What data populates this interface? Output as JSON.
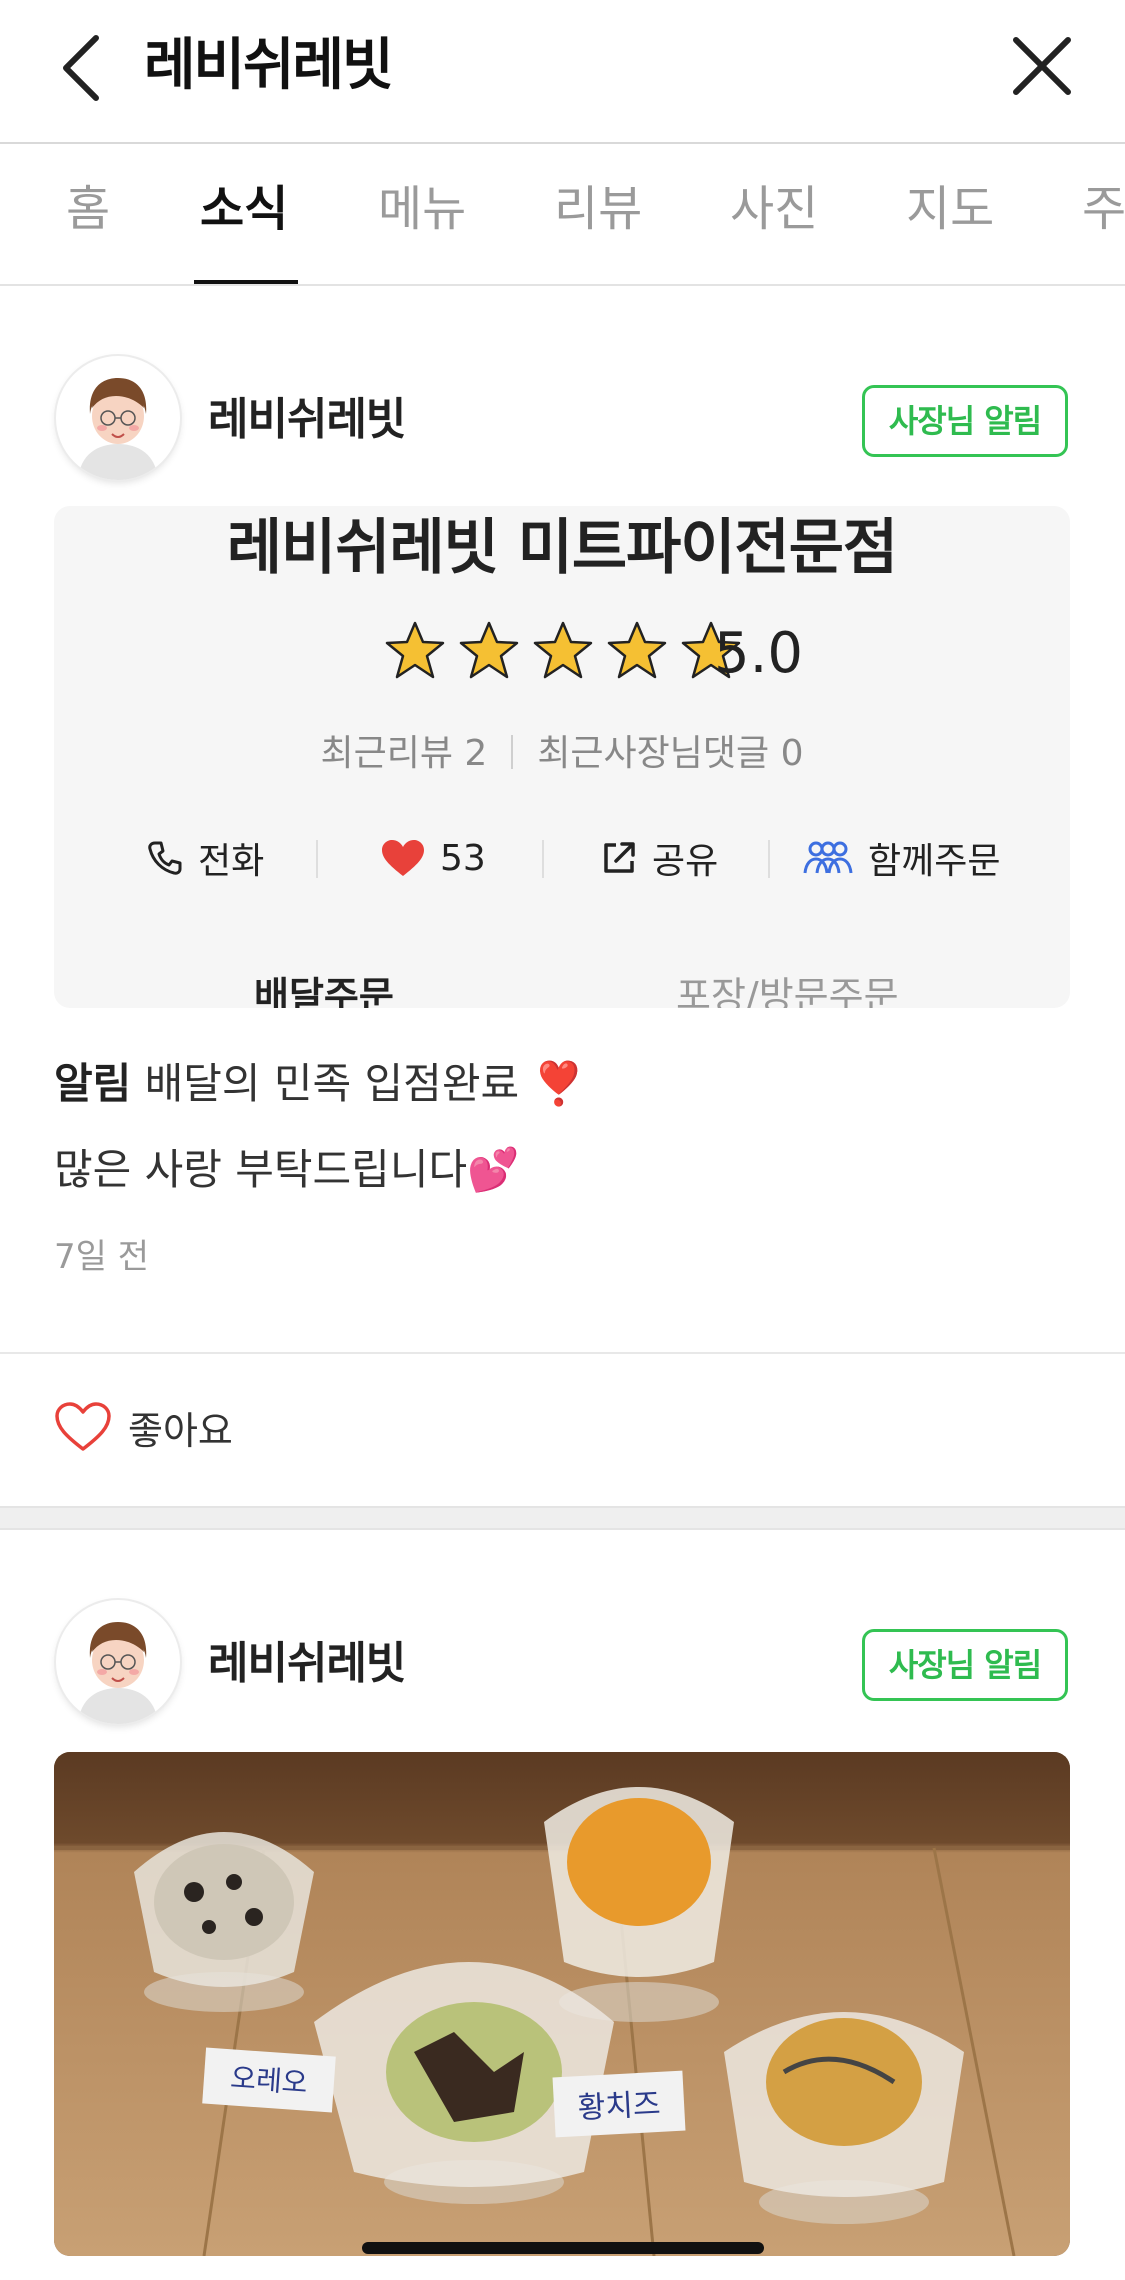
{
  "header": {
    "title": "레비쉬레빗",
    "back_icon": "chevron-left-icon",
    "close_icon": "close-icon"
  },
  "tabs": [
    {
      "label": "홈",
      "active": false
    },
    {
      "label": "소식",
      "active": true
    },
    {
      "label": "메뉴",
      "active": false
    },
    {
      "label": "리뷰",
      "active": false
    },
    {
      "label": "사진",
      "active": false
    },
    {
      "label": "지도",
      "active": false
    },
    {
      "label": "주",
      "active": false
    }
  ],
  "posts": [
    {
      "author": "레비쉬레빗",
      "badge": "사장님 알림",
      "card": {
        "title": "레비쉬레빗 미트파이전문점",
        "rating": "5.0",
        "stars": 5,
        "recent_reviews": "최근리뷰 2",
        "recent_owner_replies": "최근사장님댓글 0",
        "actions": {
          "call": "전화",
          "likes": "53",
          "share": "공유",
          "group_order": "함께주문"
        },
        "order_tabs": {
          "delivery": "배달주문",
          "pickup": "포장/방문주문"
        }
      },
      "text_label": "알림",
      "text_line1": "배달의 민족 입점완료 ❣️",
      "text_line2": "많은 사랑 부탁드립니다💕",
      "time": "7일 전",
      "like_label": "좋아요"
    },
    {
      "author": "레비쉬레빗",
      "badge": "사장님 알림",
      "photo_labels": [
        "오레오",
        "황치즈"
      ]
    }
  ],
  "colors": {
    "accent_green": "#34c454",
    "heart_red": "#e8413a",
    "star_gold": "#f5c033",
    "group_blue": "#3d6fe0"
  }
}
